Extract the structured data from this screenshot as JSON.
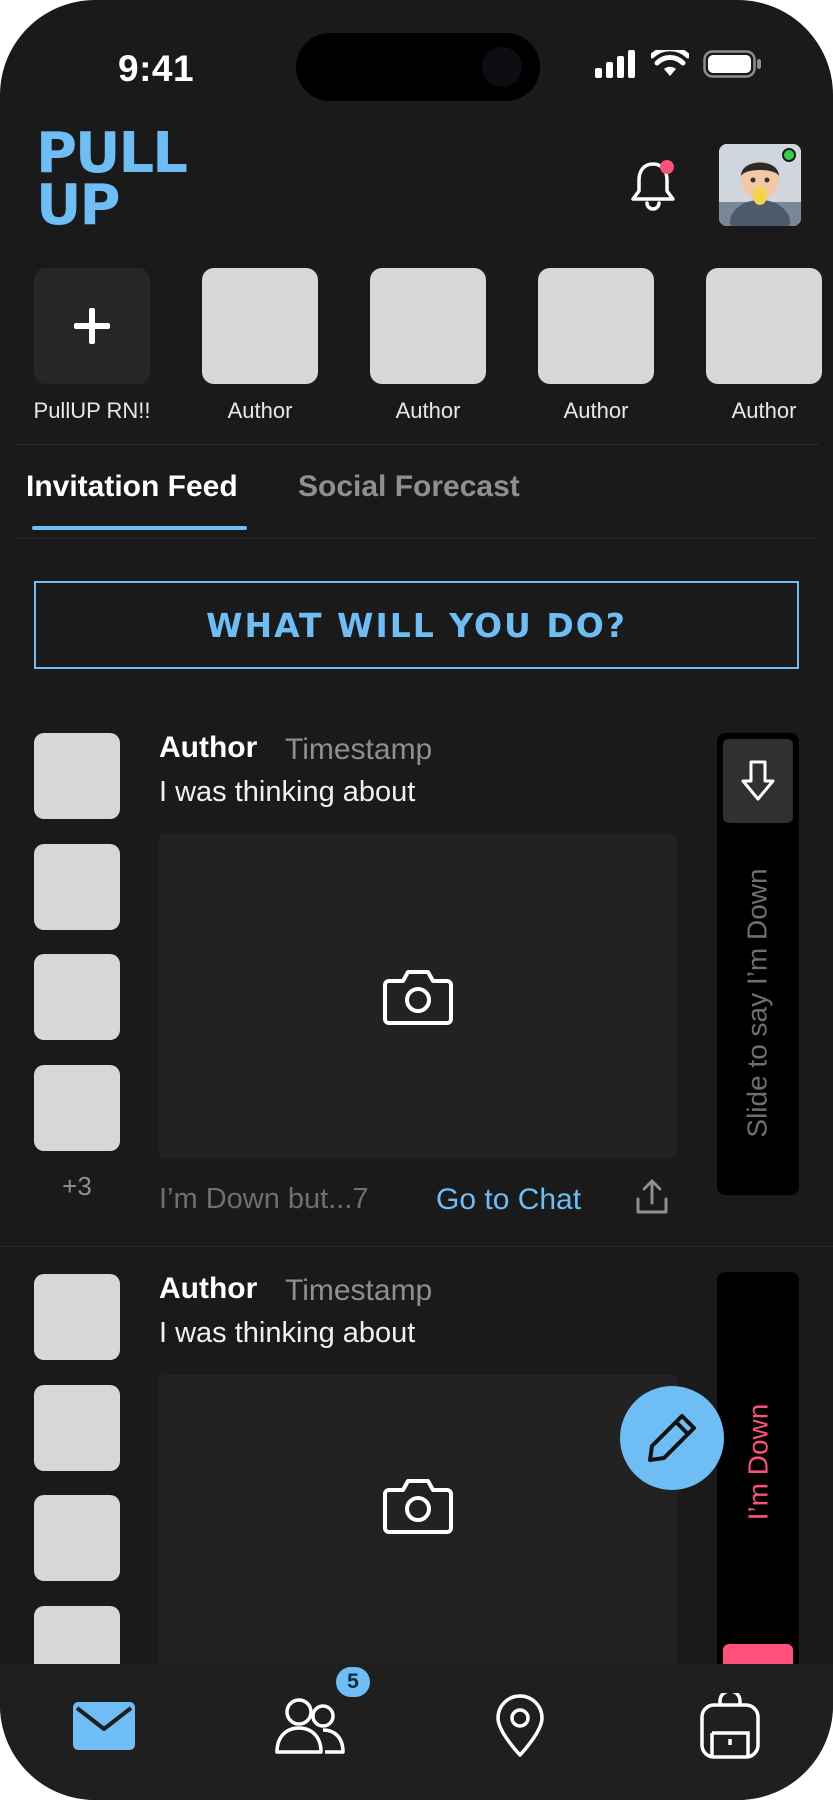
{
  "status_bar": {
    "time": "9:41"
  },
  "header": {
    "logo_line1": "PULL",
    "logo_line2": "UP"
  },
  "stories": [
    {
      "label": "PullUP RN!!",
      "type": "add",
      "icon": "plus-icon"
    },
    {
      "label": "Author"
    },
    {
      "label": "Author"
    },
    {
      "label": "Author"
    },
    {
      "label": "Author"
    }
  ],
  "tabs": [
    {
      "label": "Invitation Feed",
      "active": true
    },
    {
      "label": "Social Forecast",
      "active": false
    }
  ],
  "cta": {
    "label": "WHAT WILL YOU DO?"
  },
  "posts": [
    {
      "author": "Author",
      "timestamp": "Timestamp",
      "text": "I was thinking about",
      "more_count": "+3",
      "down_text": "I’m Down but...7",
      "chat_label": "Go to Chat",
      "slider_label": "Slide to say I’m Down"
    },
    {
      "author": "Author",
      "timestamp": "Timestamp",
      "text": "I was thinking about",
      "slider_label": "I’m Down"
    }
  ],
  "nav": {
    "items": [
      "mail-icon",
      "friends-icon",
      "location-icon",
      "backpack-icon"
    ],
    "friends_badge": "5"
  },
  "colors": {
    "accent": "#6ebdf5",
    "pink": "#ff4f7b",
    "background": "#1a1a1a"
  }
}
